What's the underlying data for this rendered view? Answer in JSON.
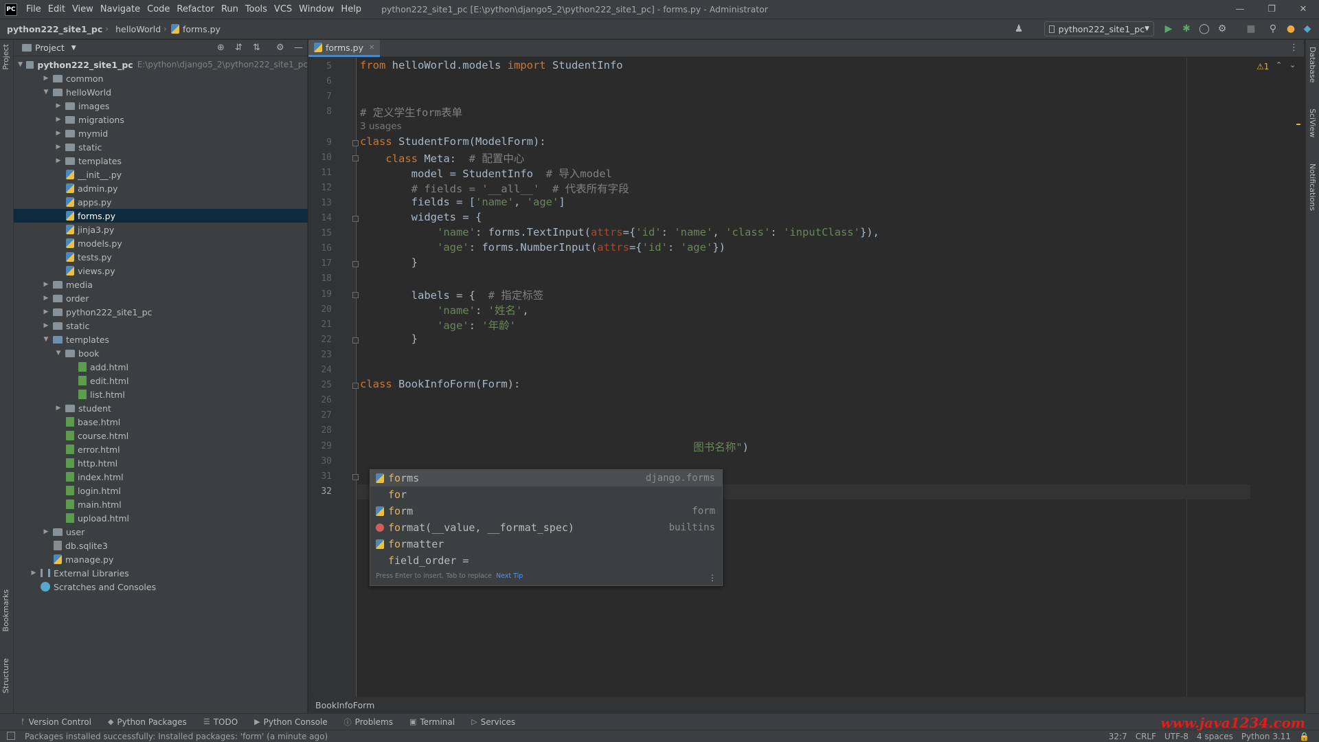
{
  "titlebar": {
    "logo": "PC",
    "menus": [
      "File",
      "Edit",
      "View",
      "Navigate",
      "Code",
      "Refactor",
      "Run",
      "Tools",
      "VCS",
      "Window",
      "Help"
    ],
    "window_title": "python222_site1_pc [E:\\python\\django5_2\\python222_site1_pc] - forms.py - Administrator",
    "controls": [
      "—",
      "❐",
      "✕"
    ]
  },
  "navbar": {
    "crumbs": [
      "python222_site1_pc",
      "helloWorld",
      "forms.py"
    ],
    "run_config": "python222_site1_pc"
  },
  "project": {
    "header": "Project",
    "root_name": "python222_site1_pc",
    "root_path": "E:\\python\\django5_2\\python222_site1_pc",
    "tree": [
      {
        "label": "common",
        "type": "folder",
        "depth": 1,
        "arrow": "right"
      },
      {
        "label": "helloWorld",
        "type": "folder",
        "depth": 1,
        "arrow": "down"
      },
      {
        "label": "images",
        "type": "folder",
        "depth": 2,
        "arrow": "right"
      },
      {
        "label": "migrations",
        "type": "folder",
        "depth": 2,
        "arrow": "right"
      },
      {
        "label": "mymid",
        "type": "folder",
        "depth": 2,
        "arrow": "right"
      },
      {
        "label": "static",
        "type": "folder",
        "depth": 2,
        "arrow": "right"
      },
      {
        "label": "templates",
        "type": "folder",
        "depth": 2,
        "arrow": "right"
      },
      {
        "label": "__init__.py",
        "type": "py",
        "depth": 2
      },
      {
        "label": "admin.py",
        "type": "py",
        "depth": 2
      },
      {
        "label": "apps.py",
        "type": "py",
        "depth": 2
      },
      {
        "label": "forms.py",
        "type": "py",
        "depth": 2,
        "selected": true
      },
      {
        "label": "jinja3.py",
        "type": "py",
        "depth": 2
      },
      {
        "label": "models.py",
        "type": "py",
        "depth": 2
      },
      {
        "label": "tests.py",
        "type": "py",
        "depth": 2
      },
      {
        "label": "views.py",
        "type": "py",
        "depth": 2
      },
      {
        "label": "media",
        "type": "folder",
        "depth": 1,
        "arrow": "right"
      },
      {
        "label": "order",
        "type": "folder",
        "depth": 1,
        "arrow": "right"
      },
      {
        "label": "python222_site1_pc",
        "type": "folder",
        "depth": 1,
        "arrow": "right"
      },
      {
        "label": "static",
        "type": "folder",
        "depth": 1,
        "arrow": "right"
      },
      {
        "label": "templates",
        "type": "folder-blue",
        "depth": 1,
        "arrow": "down"
      },
      {
        "label": "book",
        "type": "folder",
        "depth": 2,
        "arrow": "down"
      },
      {
        "label": "add.html",
        "type": "html",
        "depth": 3
      },
      {
        "label": "edit.html",
        "type": "html",
        "depth": 3
      },
      {
        "label": "list.html",
        "type": "html",
        "depth": 3
      },
      {
        "label": "student",
        "type": "folder",
        "depth": 2,
        "arrow": "right"
      },
      {
        "label": "base.html",
        "type": "html",
        "depth": 2
      },
      {
        "label": "course.html",
        "type": "html",
        "depth": 2
      },
      {
        "label": "error.html",
        "type": "html",
        "depth": 2
      },
      {
        "label": "http.html",
        "type": "html",
        "depth": 2
      },
      {
        "label": "index.html",
        "type": "html",
        "depth": 2
      },
      {
        "label": "login.html",
        "type": "html",
        "depth": 2
      },
      {
        "label": "main.html",
        "type": "html",
        "depth": 2
      },
      {
        "label": "upload.html",
        "type": "html",
        "depth": 2
      },
      {
        "label": "user",
        "type": "folder",
        "depth": 1,
        "arrow": "right"
      },
      {
        "label": "db.sqlite3",
        "type": "db",
        "depth": 1
      },
      {
        "label": "manage.py",
        "type": "py",
        "depth": 1
      },
      {
        "label": "External Libraries",
        "type": "lib",
        "depth": 0,
        "arrow": "right"
      },
      {
        "label": "Scratches and Consoles",
        "type": "scratch",
        "depth": 0
      }
    ]
  },
  "editor": {
    "tab": "forms.py",
    "warning": "⚠1",
    "usages": "3 usages",
    "lines": [
      {
        "n": "5",
        "html": "<span class='k'>from</span> helloWorld.models <span class='k'>import</span> StudentInfo"
      },
      {
        "n": "6",
        "html": ""
      },
      {
        "n": "7",
        "html": ""
      },
      {
        "n": "8",
        "html": "<span class='c'># 定义学生form表单</span>"
      },
      {
        "n": "9",
        "html": "<span class='k'>class</span> StudentForm(ModelForm):"
      },
      {
        "n": "10",
        "html": "    <span class='k'>class</span> Meta:  <span class='c'># 配置中心</span>"
      },
      {
        "n": "11",
        "html": "        model = StudentInfo  <span class='c'># 导入model</span>"
      },
      {
        "n": "12",
        "html": "        <span class='c'># fields = '__all__'  # 代表所有字段</span>"
      },
      {
        "n": "13",
        "html": "        fields = [<span class='s'>'name'</span>, <span class='s'>'age'</span>]"
      },
      {
        "n": "14",
        "html": "        widgets = {"
      },
      {
        "n": "15",
        "html": "            <span class='s'>'name'</span>: forms.TextInput(<span class='p'>attrs</span>={<span class='s'>'id'</span>: <span class='s'>'name'</span>, <span class='s'>'class'</span>: <span class='s'>'inputClass'</span>}),"
      },
      {
        "n": "16",
        "html": "            <span class='s'>'age'</span>: forms.NumberInput(<span class='p'>attrs</span>={<span class='s'>'id'</span>: <span class='s'>'age'</span>})"
      },
      {
        "n": "17",
        "html": "        }"
      },
      {
        "n": "18",
        "html": ""
      },
      {
        "n": "19",
        "html": "        labels = {  <span class='c'># 指定标签</span>"
      },
      {
        "n": "20",
        "html": "            <span class='s'>'name'</span>: <span class='s'>'姓名'</span>,"
      },
      {
        "n": "21",
        "html": "            <span class='s'>'age'</span>: <span class='s'>'年龄'</span>"
      },
      {
        "n": "22",
        "html": "        }"
      },
      {
        "n": "23",
        "html": ""
      },
      {
        "n": "24",
        "html": ""
      },
      {
        "n": "25",
        "html": "<span class='k'>class</span> BookInfoForm(Form):"
      },
      {
        "n": "26",
        "html": ""
      },
      {
        "n": "27",
        "html": ""
      },
      {
        "n": "28",
        "html": ""
      },
      {
        "n": "29",
        "html": "                                                    <span class='s'>图书名称\"</span>)"
      },
      {
        "n": "30",
        "html": ""
      },
      {
        "n": "31",
        "html": ""
      },
      {
        "n": "32",
        "html": "    fo",
        "current": true
      }
    ]
  },
  "completion": {
    "items": [
      {
        "icon": "py",
        "match": "fo",
        "rest": "rms",
        "type": "django.forms",
        "selected": true
      },
      {
        "icon": "none",
        "match": "fo",
        "rest": "r",
        "type": ""
      },
      {
        "icon": "py",
        "match": "fo",
        "rest": "rm",
        "type": "form"
      },
      {
        "icon": "fn",
        "match": "fo",
        "rest": "rmat(__value, __format_spec)",
        "type": "builtins"
      },
      {
        "icon": "py",
        "match": "fo",
        "rest": "rmatter",
        "type": ""
      },
      {
        "icon": "none",
        "match": "f",
        "rest": "ield_order =",
        "type": ""
      }
    ],
    "footer": "Press Enter to insert, Tab to replace",
    "tip": "Next Tip"
  },
  "editor_breadcrumb": "BookInfoForm",
  "toolwindows": [
    "Version Control",
    "Python Packages",
    "TODO",
    "Python Console",
    "Problems",
    "Terminal",
    "Services"
  ],
  "toolwindow_icons": [
    "ᚠ",
    "◆",
    "☰",
    "▶",
    "ⓘ",
    "▣",
    "▷"
  ],
  "statusbar": {
    "message": "Packages installed successfully: Installed packages: 'form' (a minute ago)",
    "position": "32:7",
    "line_sep": "CRLF",
    "encoding": "UTF-8",
    "indent": "4 spaces",
    "interpreter": "Python 3.11"
  },
  "side_tabs": {
    "left": [
      "Project",
      "Bookmarks",
      "Structure"
    ],
    "right": [
      "Database",
      "SciView",
      "Notifications"
    ]
  },
  "watermark": "www.java1234.com"
}
